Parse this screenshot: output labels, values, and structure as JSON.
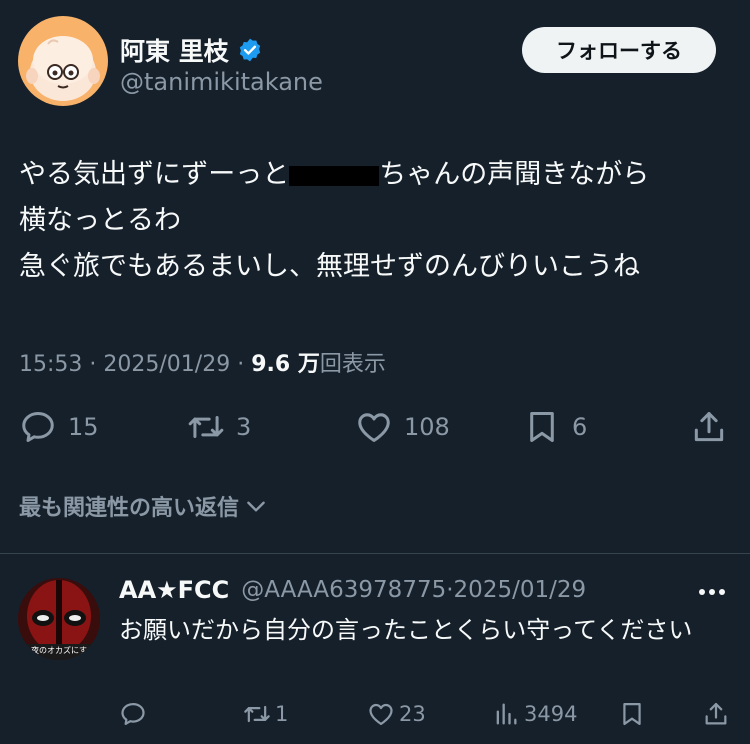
{
  "tweet": {
    "author_name": "阿東 里枝",
    "author_handle": "@tanimikitakane",
    "follow_label": "フォローする",
    "lines": [
      {
        "before": "やる気出ずにずーっと",
        "after": "ちゃんの声聞きながら"
      },
      {
        "text": "横なっとるわ"
      },
      {
        "text": "急ぐ旅でもあるまいし、無理せずのんびりいこうね"
      }
    ],
    "time": "15:53",
    "date": "2025/01/29",
    "views_count": "9.6 万",
    "views_label": "回表示",
    "replies": "15",
    "retweets": "3",
    "likes": "108",
    "bookmarks": "6"
  },
  "replies_section": {
    "title": "最も関連性の高い返信"
  },
  "reply": {
    "name": "AA★FCC",
    "handle": "@AAAA63978775",
    "date": "2025/01/29",
    "text": "お願いだから自分の言ったことくらい守ってください",
    "avatar_caption": "今夜のオカズにする",
    "retweets": "1",
    "likes": "23",
    "views": "3494"
  },
  "colors": {
    "background": "#15202b",
    "secondary_text": "#8b98a5",
    "verified": "#1d9bf0",
    "divider": "#38444d"
  }
}
